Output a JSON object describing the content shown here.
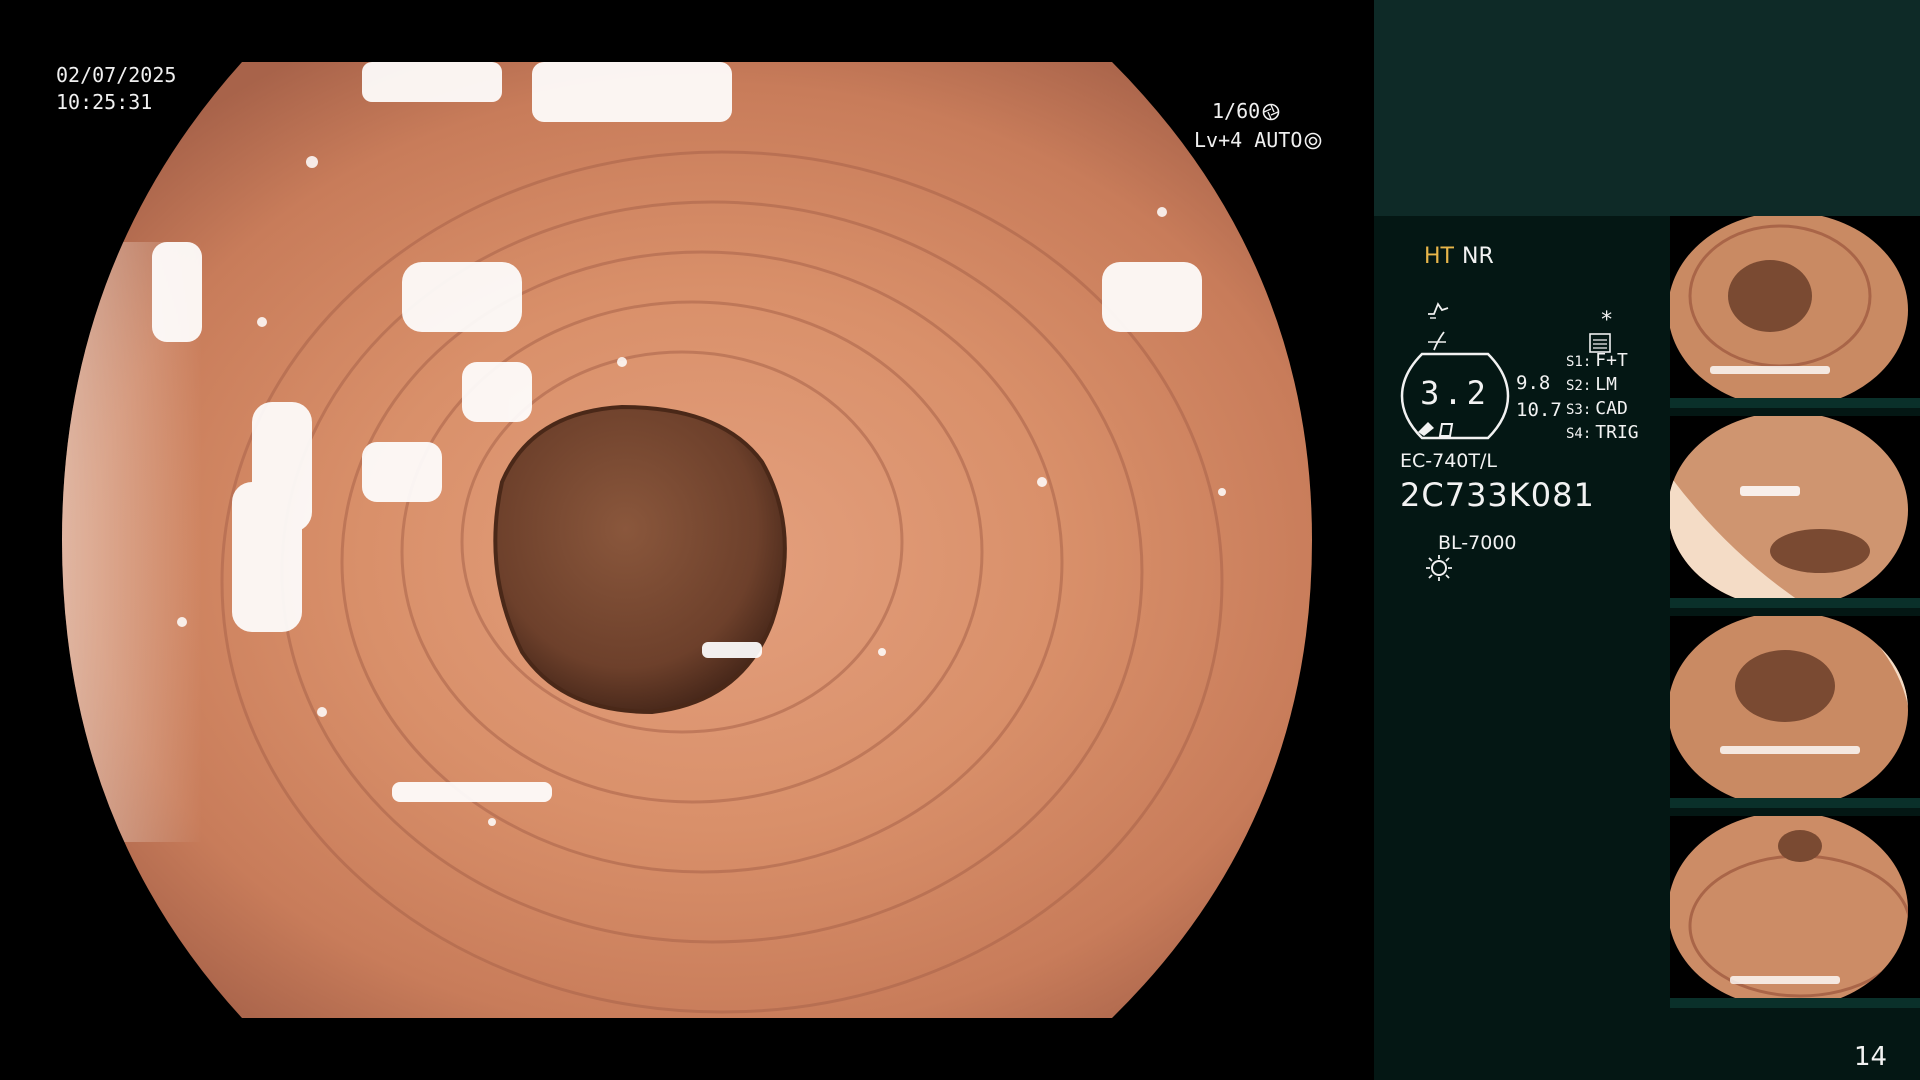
{
  "overlay": {
    "date": "02/07/2025",
    "time": "10:25:31",
    "shutter": "1/60",
    "level": "Lv+4 AUTO"
  },
  "panel": {
    "mode_ht": "HT",
    "mode_nr": "NR",
    "mark": "*",
    "zoom_value": "3.2",
    "value_a": "9.8",
    "value_b": "10.7",
    "switches": [
      {
        "key": "S1:",
        "value": "F+T"
      },
      {
        "key": "S2:",
        "value": "LM"
      },
      {
        "key": "S3:",
        "value": "CAD"
      },
      {
        "key": "S4:",
        "value": "TRIG"
      }
    ],
    "scope_model": "EC-740T/L",
    "scope_serial": "2C733K081",
    "light_source": "BL-7000"
  },
  "thumbnails": [
    {
      "id": "thumb-1"
    },
    {
      "id": "thumb-2"
    },
    {
      "id": "thumb-3"
    },
    {
      "id": "thumb-4"
    }
  ],
  "frame_counter": "14",
  "colors": {
    "mucosa": "#d99873",
    "mucosa_dark": "#b86e4e",
    "lumen": "#6b3f2a",
    "panel_bg": "#041714",
    "panel_top": "#0e2a27",
    "accent_ht": "#e8b64a"
  }
}
